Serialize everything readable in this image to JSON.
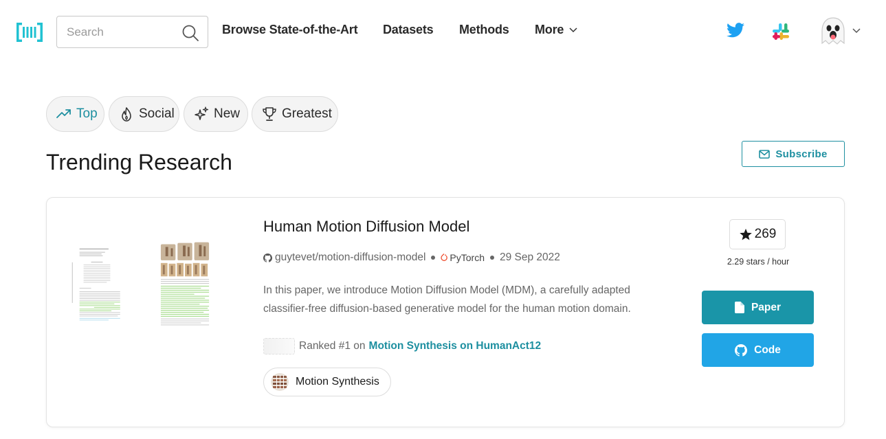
{
  "nav": {
    "logo_icon": "paperswithcode-logo-icon",
    "search_placeholder": "Search",
    "links": [
      "Browse State-of-the-Art",
      "Datasets",
      "Methods",
      "More"
    ],
    "icons": [
      "twitter-icon",
      "slack-icon",
      "ghost-avatar-icon"
    ]
  },
  "filters": [
    {
      "label": "Top",
      "icon": "trending-up-icon",
      "active": true
    },
    {
      "label": "Social",
      "icon": "flame-icon",
      "active": false
    },
    {
      "label": "New",
      "icon": "sparkles-icon",
      "active": false
    },
    {
      "label": "Greatest",
      "icon": "trophy-icon",
      "active": false
    }
  ],
  "page_title": "Trending Research",
  "subscribe_label": "Subscribe",
  "paper": {
    "title": "Human Motion Diffusion Model",
    "repo": "guytevet/motion-diffusion-model",
    "framework": "PyTorch",
    "date": "29 Sep 2022",
    "abstract": "In this paper, we introduce Motion Diffusion Model (MDM), a carefully adapted classifier-free diffusion-based generative model for the human motion domain.",
    "ranked_prefix": "Ranked #1 on",
    "ranked_link": "Motion Synthesis on HumanAct12",
    "task": "Motion Synthesis",
    "stars": "269",
    "stars_rate": "2.29 stars / hour",
    "paper_button": "Paper",
    "code_button": "Code"
  },
  "colors": {
    "accent": "#1d8fa0",
    "paper_button": "#1a95a8",
    "code_button": "#21a5e6",
    "logo": "#21c2d2"
  }
}
